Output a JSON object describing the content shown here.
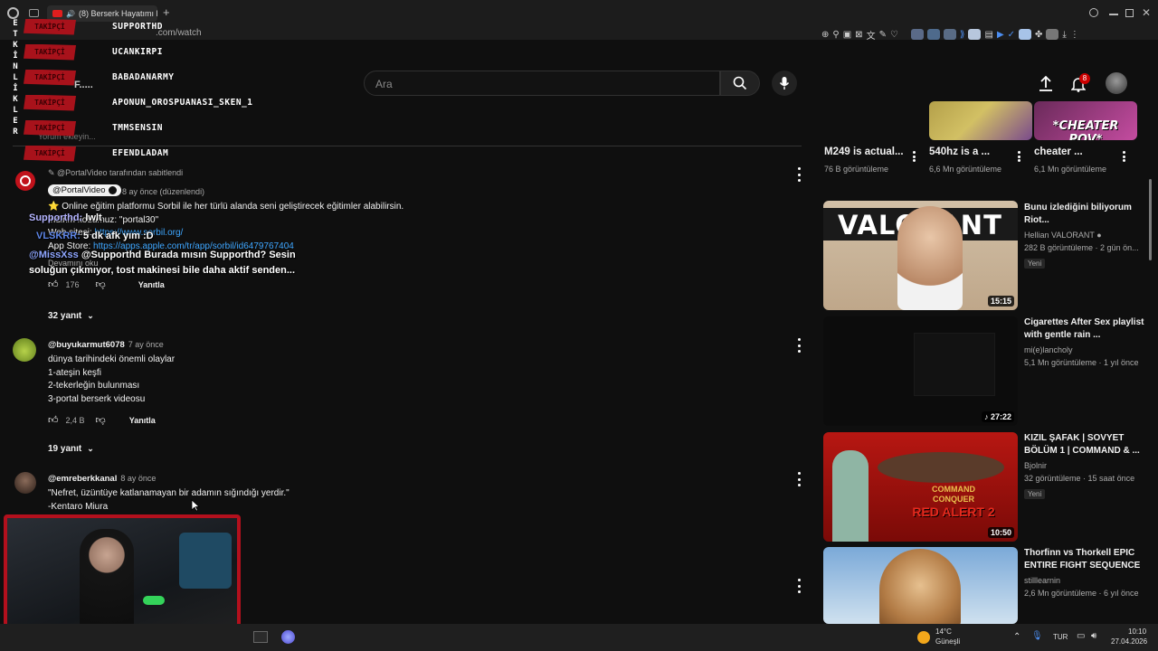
{
  "browser": {
    "tab_title": "(8) Berserk Hayatımı D",
    "url": ".com/watch"
  },
  "header": {
    "search_placeholder": "Ara",
    "notification_count": "8"
  },
  "overlay": {
    "vertical_label": [
      "E",
      "T",
      "K",
      "İ",
      "N",
      "L",
      "İ",
      "K",
      "L",
      "E",
      "R"
    ],
    "followers": [
      {
        "tag": "TAKİPÇİ",
        "name": "SUPPORTHD"
      },
      {
        "tag": "TAKİPÇİ",
        "name": "UCANKIRPI"
      },
      {
        "tag": "TAKİPÇİ",
        "name": "BABADANARMY"
      },
      {
        "tag": "TAKİPÇİ",
        "name": "APONUN_OROSPUANASI_SKEN_1"
      },
      {
        "tag": "TAKİPÇİ",
        "name": "TMMSENSIN"
      },
      {
        "tag": "TAKİPÇİ",
        "name": "EFENDLADAM"
      }
    ],
    "chat": [
      {
        "user": "Supporthd:",
        "text": "lwlt"
      },
      {
        "user": "VLSKRR:",
        "text": "5 dk afk yım :D"
      },
      {
        "user": "@MissXss",
        "text": "@Supporthd Burada mısın Supporthd? Sesin soluğun çıkmıyor, tost makinesi bile daha aktif senden..."
      }
    ],
    "partial_text": {
      "behind_1": "Yorum ekleyin...",
      "behind_2": "Yorum ekleyin...",
      "channel_fragment": "F....."
    }
  },
  "comments": {
    "pinned": {
      "pinned_by": "@PortalVideo tarafından sabitlendi",
      "author": "@PortalVideo",
      "time": "8 ay önce (düzenlendi)",
      "lines": [
        "⭐ Online eğitim platformu Sorbil ile her türlü alanda seni geliştirecek eğitimler alabilirsin.",
        "İndirim kodumuz: \"portal30\"",
        "Web sitesi: https://www.sorbil.org/",
        "App Store: https://apps.apple.com/tr/app/sorbil/id6479767404"
      ],
      "read_more": "Devamını oku",
      "likes": "176",
      "reply_label": "Yanıtla",
      "replies": "32 yanıt"
    },
    "c2": {
      "author": "@buyukarmut6078",
      "time": "7 ay önce",
      "lines": [
        "dünya tarihindeki önemli olaylar",
        "1-ateşin keşfi",
        "2-tekerleğin bulunması",
        "3-portal berserk videosu"
      ],
      "likes": "2,4 B",
      "reply_label": "Yanıtla",
      "replies": "19 yanıt"
    },
    "c3": {
      "author": "@emreberkkanal",
      "time": "8 ay önce",
      "lines": [
        "\"Nefret, üzüntüye katlanamayan bir adamın sığındığı yerdir.\"",
        "-Kentaro Miura"
      ]
    }
  },
  "sidebar": {
    "shorts": [
      {
        "title": "M249 is actual...",
        "views": "76 B görüntüleme"
      },
      {
        "title": "540hz is a ...",
        "views": "6,6 Mn görüntüleme"
      },
      {
        "title": "cheater ...",
        "views": "6,1 Mn görüntüleme",
        "overlay": "*CHEATER POV*"
      }
    ],
    "videos": [
      {
        "title": "Bunu izlediğini biliyorum Riot...",
        "channel": "Hellian VALORANT",
        "meta": "282 B görüntüleme · 2 gün ön...",
        "badge": "Yeni",
        "duration": "15:15",
        "thumb_text": "VALORANT"
      },
      {
        "title": "Cigarettes After Sex playlist with gentle rain ...",
        "channel": "mi(e)lancholy",
        "meta": "5,1 Mn görüntüleme · 1 yıl önce",
        "duration": "27:22"
      },
      {
        "title": "KIZIL ŞAFAK | SOVYET BÖLÜM 1 | COMMAND & ...",
        "channel": "Bjolnir",
        "meta": "32 görüntüleme · 15 saat önce",
        "badge": "Yeni",
        "duration": "10:50",
        "thumb_text_1": "COMMAND",
        "thumb_text_2": "CONQUER",
        "thumb_text_3": "RED ALERT",
        "thumb_text_4": "2"
      },
      {
        "title": "Thorfinn vs Thorkell EPIC ENTIRE FIGHT SEQUENCE",
        "channel": "stilllearnin",
        "meta": "2,6 Mn görüntüleme · 6 yıl önce"
      }
    ]
  },
  "taskbar": {
    "temp": "14°C",
    "weather": "Güneşli",
    "lang": "TUR",
    "time": "10:10",
    "date": "27.04.2026"
  }
}
